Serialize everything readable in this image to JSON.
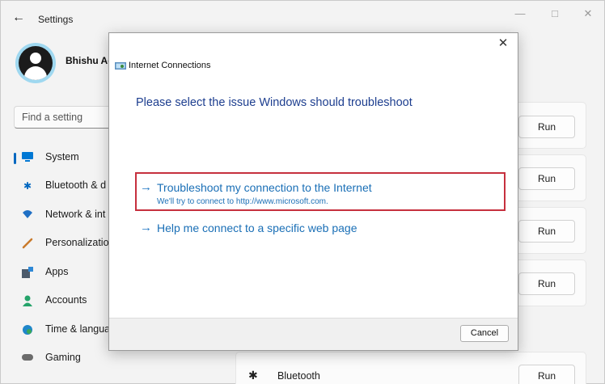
{
  "settings": {
    "title": "Settings",
    "user_name": "Bhishu Ac",
    "search_placeholder": "Find a setting",
    "nav": [
      {
        "label": "System",
        "icon": "system-icon",
        "color": "#0078d4"
      },
      {
        "label": "Bluetooth & d",
        "icon": "bluetooth-icon",
        "color": "#0067c0"
      },
      {
        "label": "Network & int",
        "icon": "network-icon",
        "color": "#1f6fc4"
      },
      {
        "label": "Personalization",
        "icon": "brush-icon",
        "color": "#c97a2b"
      },
      {
        "label": "Apps",
        "icon": "apps-icon",
        "color": "#4b5a6b"
      },
      {
        "label": "Accounts",
        "icon": "accounts-icon",
        "color": "#25a36a"
      },
      {
        "label": "Time & langua",
        "icon": "globe-icon",
        "color": "#1f86c9"
      },
      {
        "label": "Gaming",
        "icon": "gaming-icon",
        "color": "#6b6b6b"
      }
    ],
    "run_label": "Run",
    "bluetooth_row_label": "Bluetooth"
  },
  "dialog": {
    "title": "Internet Connections",
    "heading": "Please select the issue Windows should troubleshoot",
    "options": [
      {
        "title": "Troubleshoot my connection to the Internet",
        "desc": "We'll try to connect to http://www.microsoft.com."
      },
      {
        "title": "Help me connect to a specific web page",
        "desc": ""
      }
    ],
    "cancel_label": "Cancel",
    "highlight_color": "#c6303e"
  }
}
